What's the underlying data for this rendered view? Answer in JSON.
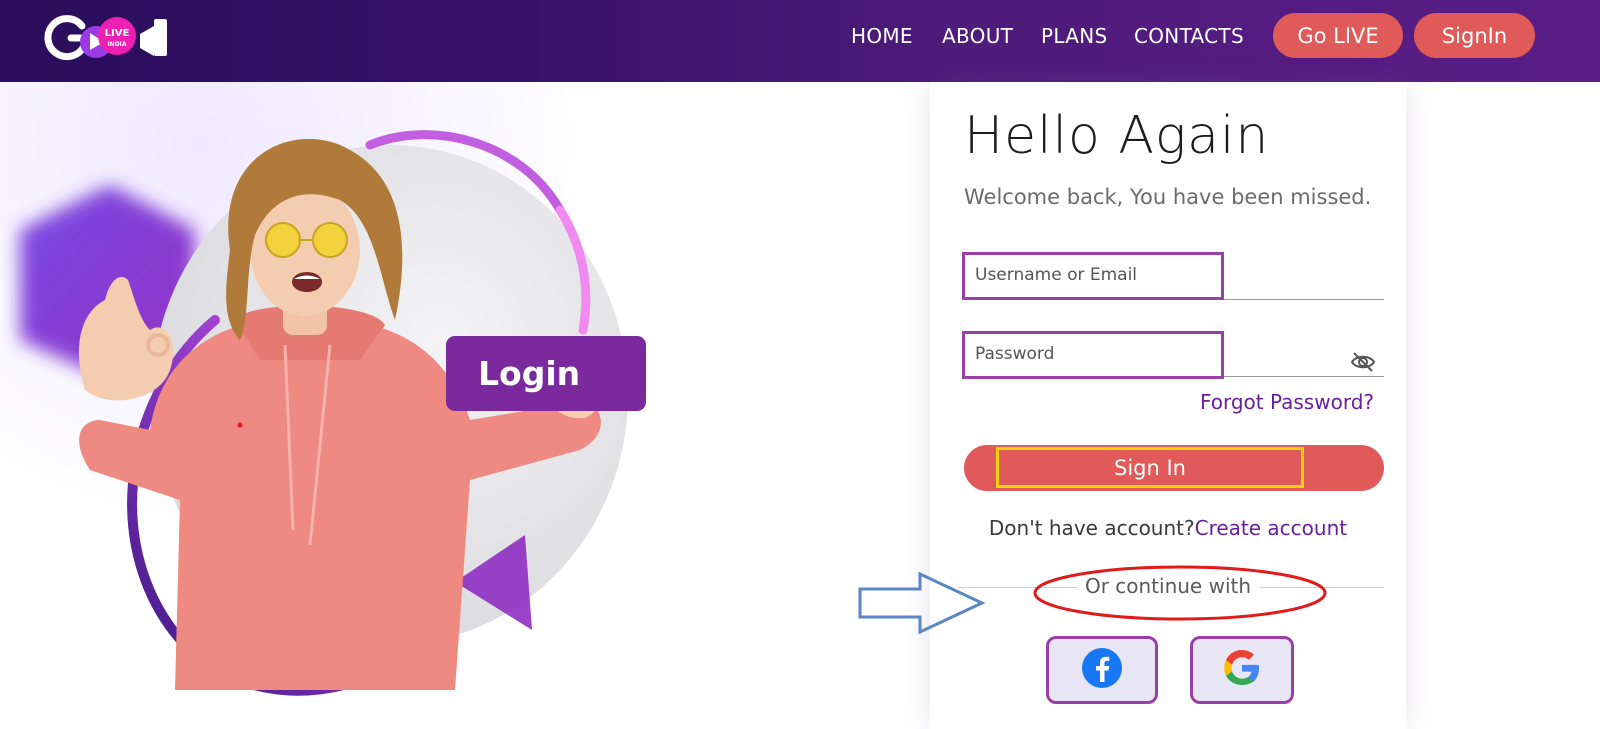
{
  "navbar": {
    "logo_text": "LIVE INDIA",
    "links": [
      "HOME",
      "ABOUT",
      "PLANS",
      "CONTACTS"
    ],
    "go_live_label": "Go LIVE",
    "signin_label": "SignIn"
  },
  "hero": {
    "badge_label": "Login"
  },
  "login_card": {
    "title": "Hello Again",
    "subtitle": "Welcome back, You have been missed.",
    "username_placeholder": "Username or Email",
    "password_placeholder": "Password",
    "forgot_label": "Forgot Password?",
    "signin_button_label": "Sign In",
    "no_account_text": "Don't have account?",
    "create_account_label": "Create account",
    "continue_text": "Or continue with",
    "social": [
      "facebook-icon",
      "google-icon"
    ]
  },
  "colors": {
    "nav_gradient_start": "#2a0d5c",
    "nav_gradient_end": "#5a1d86",
    "accent_button": "#e05a5a",
    "purple_link": "#6a1f9a",
    "highlight_box": "#9a3fa8",
    "highlight_yellow": "#f2d20a",
    "annotation_red": "#e01b1b",
    "annotation_blue": "#5b86c4"
  }
}
